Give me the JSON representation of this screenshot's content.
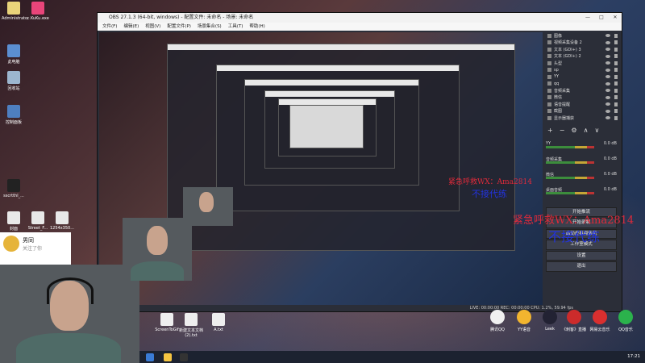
{
  "desktop": {
    "top_icons": [
      {
        "label": "Administrator"
      },
      {
        "label": "...KuKu.exe"
      }
    ],
    "left_icons": [
      {
        "label": "此电脑"
      },
      {
        "label": "回收站"
      },
      {
        "label": "控制面板"
      },
      {
        "label": "sscrtthl_..."
      },
      {
        "label": "封面"
      },
      {
        "label": "Street_F..."
      },
      {
        "label": "1254x350..."
      }
    ]
  },
  "obs": {
    "title": "OBS 27.1.3 (64-bit, windows) - 配置文件: 未命名 - 场景: 未命名",
    "menu": [
      "文件(F)",
      "编辑(E)",
      "视图(V)",
      "配置文件(P)",
      "场景集合(S)",
      "工具(T)",
      "帮助(H)"
    ],
    "sources": [
      {
        "label": "图像"
      },
      {
        "label": "视频采集设备 2"
      },
      {
        "label": "文本 (GDI+) 3"
      },
      {
        "label": "文本 (GDI+) 2"
      },
      {
        "label": "头型"
      },
      {
        "label": "sp"
      },
      {
        "label": "YY"
      },
      {
        "label": "qq"
      },
      {
        "label": "音频采集"
      },
      {
        "label": "微信"
      },
      {
        "label": "语音提醒"
      },
      {
        "label": "截图"
      },
      {
        "label": "显示器捕获"
      }
    ],
    "toolbar_symbols": [
      "+",
      "−",
      "⚙",
      "∧",
      "∨"
    ],
    "mixer": [
      {
        "label": "YY",
        "db": "0.0 dB"
      },
      {
        "label": "音频采集",
        "db": "0.0 dB"
      },
      {
        "label": "微信",
        "db": "0.0 dB"
      },
      {
        "label": "桌面音频",
        "db": "0.0 dB"
      }
    ],
    "controls": [
      {
        "label": "开始推流"
      },
      {
        "label": "开始录制"
      },
      {
        "label": "启动虚拟摄像机"
      },
      {
        "label": "工作室模式"
      },
      {
        "label": "设置"
      },
      {
        "label": "退出"
      }
    ],
    "status": "LIVE: 00:00:00  REC: 00:00:00  CPU: 1.2%, 59.94 fps"
  },
  "inner_desktop_icons": [
    {
      "label": "ScreenToGif"
    },
    {
      "label": "新建文本文档 (2).txt"
    },
    {
      "label": "A.txt"
    }
  ],
  "taskbar_apps": [
    {
      "label": "腾讯QQ"
    },
    {
      "label": "YY语音"
    },
    {
      "label": "Leek"
    },
    {
      "label": "《刺客》直播"
    },
    {
      "label": "网易云音乐"
    },
    {
      "label": "QQ音乐"
    }
  ],
  "clock": "17:21",
  "notification": {
    "name": "男同",
    "subtitle": "关注了你"
  },
  "overlay": {
    "red": "紧急呼救WX：Ama2814",
    "blue": "不接代练"
  },
  "colors": {
    "overlay_red": "#e02a3a",
    "overlay_blue": "#2233dd",
    "obs_bg": "#2b2e38"
  }
}
